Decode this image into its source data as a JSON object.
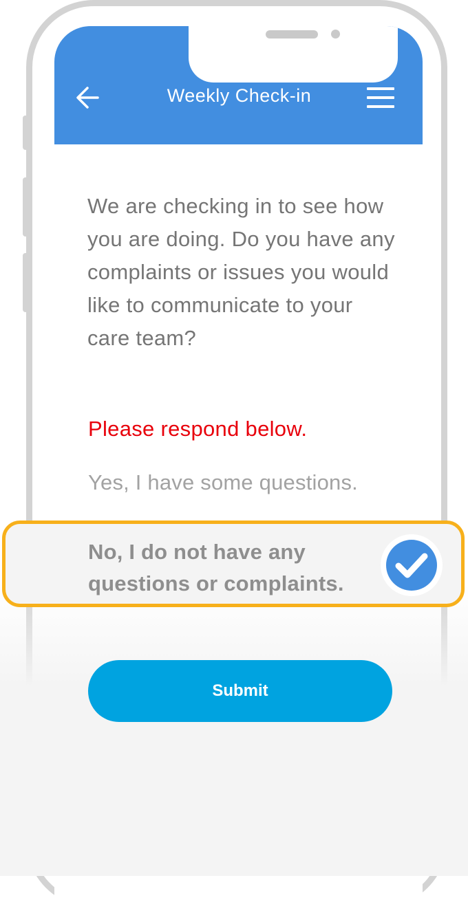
{
  "header": {
    "title": "Weekly Check-in",
    "back_icon": "arrow-left-icon",
    "menu_icon": "hamburger-menu-icon",
    "color": "#428ee0"
  },
  "main": {
    "question": "We are checking in to see how you are doing. Do you have any complaints or issues you would like to communicate to your care team?",
    "prompt": "Please respond below.",
    "prompt_color": "#e8000b",
    "options": [
      {
        "label": "Yes, I have some questions.",
        "selected": false
      },
      {
        "label": "No, I do not have any questions or complaints.",
        "selected": true
      }
    ],
    "selected_icon": "checkmark-circle-icon",
    "highlight_color": "#f7b01b"
  },
  "submit": {
    "label": "Submit",
    "color": "#00a3e0"
  }
}
